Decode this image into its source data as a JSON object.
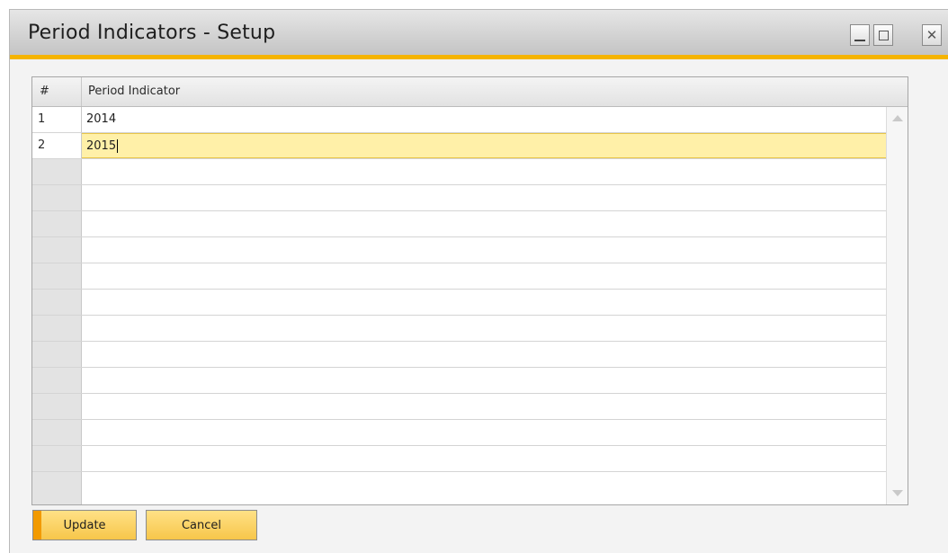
{
  "window": {
    "title": "Period Indicators - Setup",
    "controls": [
      "minimize-icon",
      "maximize-icon",
      "close-icon"
    ]
  },
  "grid": {
    "columns": [
      "#",
      "Period Indicator"
    ],
    "rows": [
      {
        "num": "1",
        "value": "2014"
      },
      {
        "num": "2",
        "value": "2015"
      }
    ],
    "active_row": 2
  },
  "actions": {
    "update_label": "Update",
    "cancel_label": "Cancel"
  },
  "colors": {
    "accent": "#f5b400",
    "active_row": "#fff0a8",
    "button": "#f7c64a"
  }
}
